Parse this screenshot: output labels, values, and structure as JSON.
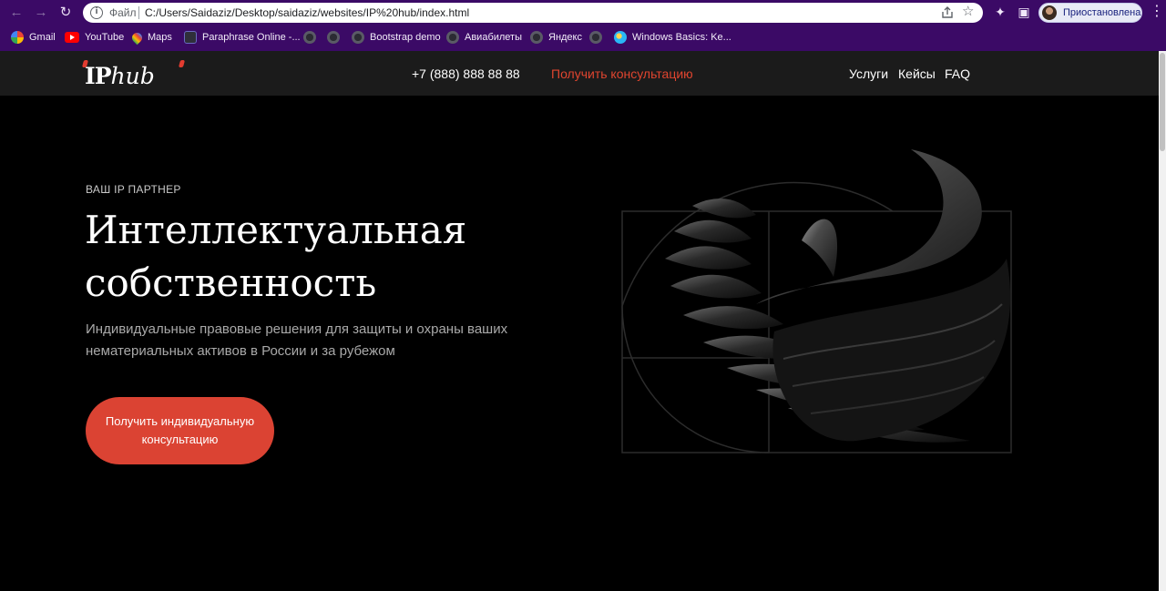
{
  "browser": {
    "address": {
      "scheme_label": "Файл",
      "url": "C:/Users/Saidaziz/Desktop/saidaziz/websites/IP%20hub/index.html"
    },
    "profile_label": "Приостановлена",
    "bookmarks": [
      {
        "label": "Gmail",
        "icon": "google-icon"
      },
      {
        "label": "YouTube",
        "icon": "youtube-icon"
      },
      {
        "label": "Maps",
        "icon": "maps-icon"
      },
      {
        "label": "Paraphrase Online -...",
        "icon": "paraphrase-icon"
      },
      {
        "label": "",
        "icon": "globe-icon"
      },
      {
        "label": "",
        "icon": "globe-icon"
      },
      {
        "label": "Bootstrap demo",
        "icon": "globe-icon"
      },
      {
        "label": "Авиабилеты",
        "icon": "globe-icon"
      },
      {
        "label": "Яндекс",
        "icon": "globe-icon"
      },
      {
        "label": "",
        "icon": "globe-icon"
      },
      {
        "label": "Windows Basics: Ke...",
        "icon": "windows-basics-icon"
      }
    ]
  },
  "site": {
    "logo": {
      "part1": "IP",
      "part2": "hub",
      "accent_color": "#e23c30"
    },
    "phone": "+7 (888) 888 88 88",
    "consult_link": "Получить консультацию",
    "nav": [
      "Услуги",
      "Кейсы",
      "FAQ"
    ],
    "hero": {
      "eyebrow": "ВАШ IP ПАРТНЕР",
      "title_line1": "Интеллектуальная",
      "title_line2": "собственность",
      "lead": "Индивидуальные правовые решения для защиты и охраны ваших нематериальных активов в России и за рубежом",
      "cta": "Получить индивидуальную консультацию",
      "cta_color": "#db4333"
    }
  }
}
